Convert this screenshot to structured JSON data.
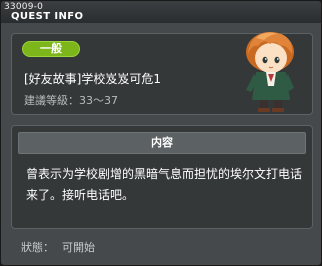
{
  "window": {
    "quest_id": "33009-0",
    "title": "QUEST INFO"
  },
  "quest": {
    "category_badge": "一般",
    "name": "[好友故事]学校岌岌可危1",
    "recommended_level_label": "建議等級：",
    "recommended_level_value": "33～37"
  },
  "content": {
    "header": "内容",
    "text": "曾表示为学校剧增的黑暗气息而担忧的埃尔文打电话来了。接听电话吧。"
  },
  "status": {
    "label": "狀態：",
    "value": "可開始"
  },
  "colors": {
    "badge_green": "#7db61b",
    "panel_bg": "#353839",
    "window_bg": "#45494c"
  }
}
